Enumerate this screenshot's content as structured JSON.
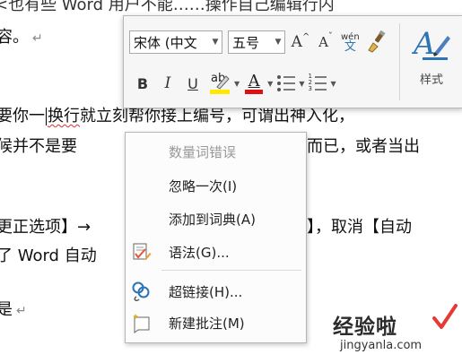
{
  "document": {
    "line1": "<也有些 Word 用户不能……操作自己编辑行内",
    "line2": "容。",
    "line3_pre": "要你一",
    "line3_err": "换行",
    "line3_post": "就立刻帮你接上编号，可谓出神入化，",
    "line4_left": "候并不是要",
    "line4_right": "而已，或者当出",
    "line5_left": "更正选项】→",
    "line5_right": "】，取消【自动",
    "line6": "了 Word 自动",
    "line7": "是",
    "paragraph_mark": "↵"
  },
  "mini_toolbar": {
    "font_name": "宋体 (中文",
    "font_size": "五号",
    "grow_font": "A",
    "shrink_font": "A",
    "phonetic_pinyin": "wén",
    "phonetic_char": "文",
    "bold": "B",
    "italic": "I",
    "underline": "U",
    "highlight_glyph": "ab",
    "font_color_glyph": "A",
    "styles_label": "样式",
    "highlight_color": "#ffe900",
    "font_color": "#dd1111",
    "accent_color": "#2e74b5"
  },
  "context_menu": {
    "items": [
      {
        "label": "数量词错误",
        "icon": "",
        "enabled": false
      },
      {
        "label": "忽略一次(I)",
        "icon": "",
        "enabled": true
      },
      {
        "label": "添加到词典(A)",
        "icon": "",
        "enabled": true
      },
      {
        "label": "语法(G)...",
        "icon": "grammar-check-icon",
        "enabled": true
      },
      {
        "label": "超链接(H)...",
        "icon": "hyperlink-icon",
        "enabled": true
      },
      {
        "label": "新建批注(M)",
        "icon": "new-comment-icon",
        "enabled": true
      }
    ]
  },
  "watermark": {
    "main": "经验啦",
    "sub": "jingyanla.com",
    "check_color": "#e53935"
  }
}
